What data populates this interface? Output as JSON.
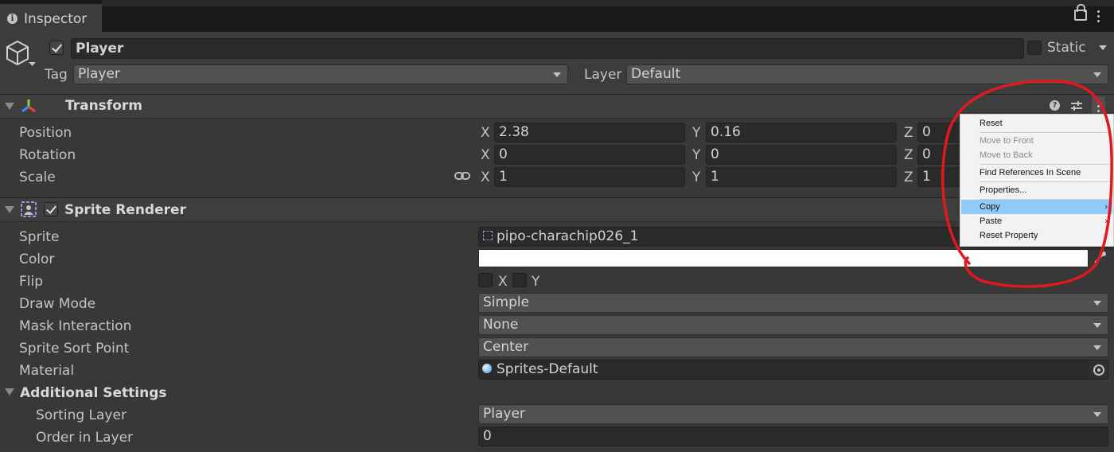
{
  "tab": {
    "title": "Inspector"
  },
  "object": {
    "name": "Player",
    "active": true,
    "static_label": "Static",
    "tag_label": "Tag",
    "tag": "Player",
    "layer_label": "Layer",
    "layer": "Default"
  },
  "transform": {
    "title": "Transform",
    "rows": [
      {
        "label": "Position",
        "x": "2.38",
        "y": "0.16",
        "z": "0"
      },
      {
        "label": "Rotation",
        "x": "0",
        "y": "0",
        "z": "0"
      },
      {
        "label": "Scale",
        "x": "1",
        "y": "1",
        "z": "1"
      }
    ],
    "axes": {
      "x": "X",
      "y": "Y",
      "z": "Z"
    }
  },
  "sprite_renderer": {
    "title": "Sprite Renderer",
    "sprite_label": "Sprite",
    "sprite": "pipo-charachip026_1",
    "color_label": "Color",
    "color": "#ffffff",
    "flip_label": "Flip",
    "flip_x": "X",
    "flip_y": "Y",
    "draw_mode_label": "Draw Mode",
    "draw_mode": "Simple",
    "mask_label": "Mask Interaction",
    "mask": "None",
    "sort_point_label": "Sprite Sort Point",
    "sort_point": "Center",
    "material_label": "Material",
    "material": "Sprites-Default",
    "additional_label": "Additional Settings",
    "sorting_layer_label": "Sorting Layer",
    "sorting_layer": "Player",
    "order_label": "Order in Layer",
    "order": "0"
  },
  "context_menu": {
    "items": [
      "Reset",
      "Move to Front",
      "Move to Back",
      "Find References In Scene",
      "Properties...",
      "Copy",
      "Paste",
      "Reset Property"
    ],
    "highlighted": "Copy"
  },
  "colors": {
    "annotation": "#e0191e",
    "highlight": "#91c9f7"
  }
}
